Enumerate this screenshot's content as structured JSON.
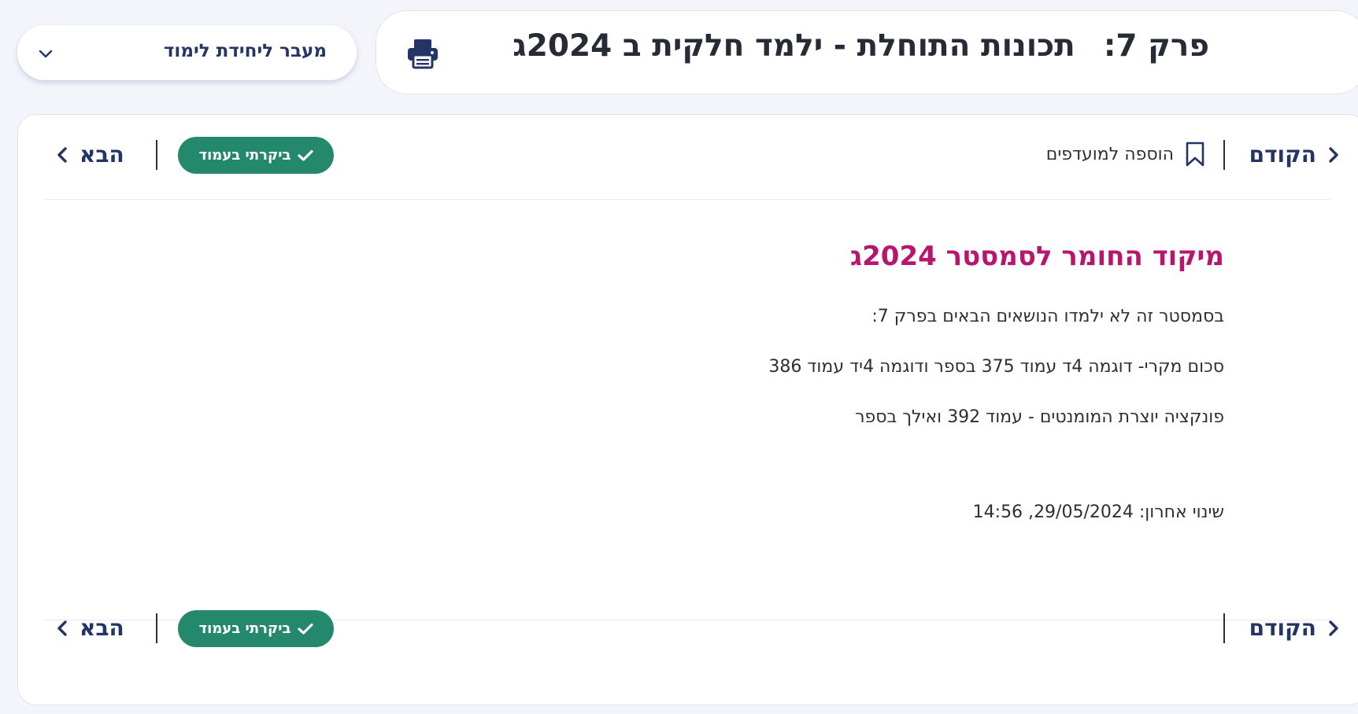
{
  "header": {
    "chapter": "פרק 7:",
    "title": "תכונות התוחלת - ילמד חלקית ב 2024ג",
    "print_icon": "print-icon"
  },
  "unit_dropdown": {
    "label": "מעבר ליחידת לימוד",
    "icon": "chevron-down-icon"
  },
  "nav": {
    "prev_label": "הקודם",
    "next_label": "הבא",
    "favorites_label": "הוספה למועדפים",
    "visited_label": "ביקרתי בעמוד",
    "prev_icon": "chevron-right-icon",
    "next_icon": "chevron-left-icon",
    "favorites_icon": "bookmark-icon",
    "visited_icon": "check-icon"
  },
  "content": {
    "heading": "מיקוד החומר לסמסטר 2024ג",
    "paragraphs": [
      "בסמסטר זה לא ילמדו הנושאים הבאים בפרק 7:",
      "סכום מקרי- דוגמה 4ד עמוד 375 בספר ודוגמה  4יד עמוד 386",
      "פונקציה יוצרת המומנטים - עמוד 392 ואילך בספר"
    ],
    "last_modified": "שינוי אחרון: 29/05/2024, 14:56"
  },
  "colors": {
    "page_bg": "#f3f5fb",
    "primary": "#243565",
    "heading_accent": "#b8166d",
    "visited_badge": "#24886c"
  }
}
